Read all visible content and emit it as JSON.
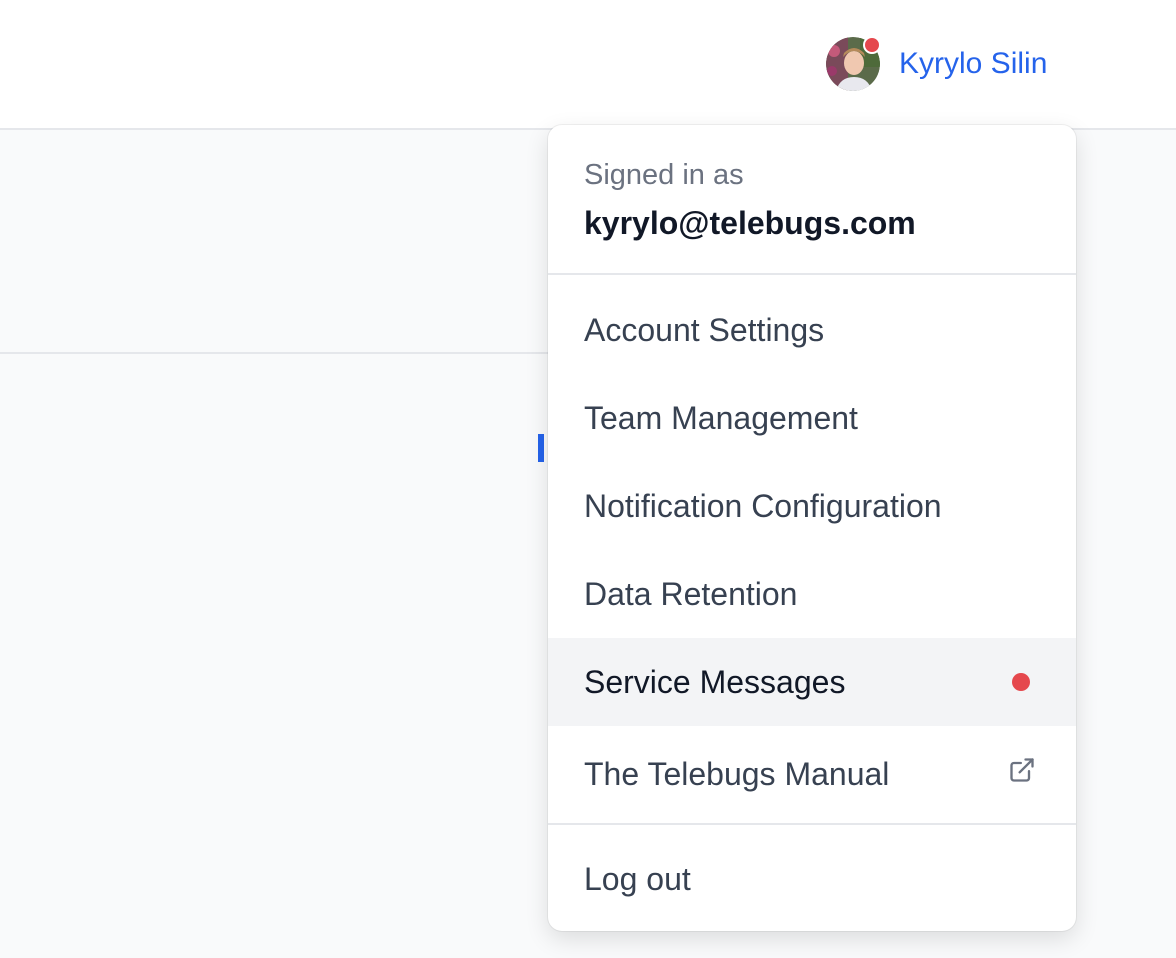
{
  "colors": {
    "link_blue": "#2563eb",
    "notification_red": "#e5484d",
    "page_bg": "#f9fafb",
    "menu_active_bg": "#f3f4f6"
  },
  "header": {
    "user_name": "Kyrylo Silin",
    "avatar_icon": "user-avatar-photo",
    "has_notification": true
  },
  "dropdown": {
    "signed_in_label": "Signed in as",
    "email": "kyrylo@telebugs.com",
    "items": [
      {
        "label": "Account Settings"
      },
      {
        "label": "Team Management"
      },
      {
        "label": "Notification Configuration"
      },
      {
        "label": "Data Retention"
      },
      {
        "label": "Service Messages",
        "active": true,
        "icon": "notification-dot-icon"
      },
      {
        "label": "The Telebugs Manual",
        "icon": "external-link-icon"
      }
    ],
    "logout_label": "Log out"
  }
}
